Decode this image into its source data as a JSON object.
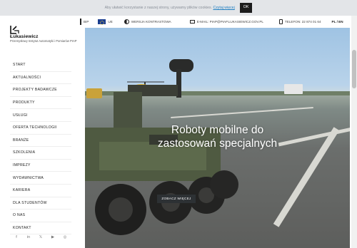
{
  "cookie_bar": {
    "text": "Aby ułatwić korzystanie z naszej strony, używamy plików cookies.",
    "link": "Czytaj więcej",
    "ok_label": "OK"
  },
  "topbar": {
    "bip_label": "BIP",
    "eu_label": "UE",
    "contrast_label": "WERSJA KONTRASTOWA",
    "email_label": "E-MAIL: PIAP@PIAP.LUKASIEWICZ.GOV.PL",
    "phone_label": "TELEFON: 22 874 01 64",
    "languages": "PL / EN",
    "icons": [
      "bip-icon",
      "eu-flag-icon",
      "contrast-icon",
      "mail-icon",
      "phone-icon",
      "search-icon"
    ]
  },
  "logo": {
    "name": "Łukasiewicz",
    "subtitle": "Przemysłowy Instytut Automatyki i Pomiarów PIAP"
  },
  "nav": {
    "items": [
      {
        "label": "START"
      },
      {
        "label": "AKTUALNOŚCI"
      },
      {
        "label": "PROJEKTY BADAWCZE"
      },
      {
        "label": "PRODUKTY"
      },
      {
        "label": "USŁUGI"
      },
      {
        "label": "OFERTA TECHNOLOGII"
      },
      {
        "label": "BRANŻE"
      },
      {
        "label": "SZKOLENIA"
      },
      {
        "label": "IMPREZY"
      },
      {
        "label": "WYDAWNICTWA"
      },
      {
        "label": "KARIERA"
      },
      {
        "label": "DLA STUDENTÓW"
      },
      {
        "label": "O NAS"
      },
      {
        "label": "KONTAKT"
      }
    ]
  },
  "socials": {
    "facebook": "f",
    "linkedin": "in",
    "x": "𝕏",
    "youtube": "▶",
    "rss": "◎"
  },
  "hero": {
    "title_line1": "Roboty mobilne do",
    "title_line2": "zastosowań specjalnych",
    "button_label": "ZOBACZ WIĘCEJ"
  },
  "colors": {
    "accent_link": "#1f7fc2",
    "button_dark": "#2d3134",
    "cookie_bg": "#e3e5e8"
  }
}
